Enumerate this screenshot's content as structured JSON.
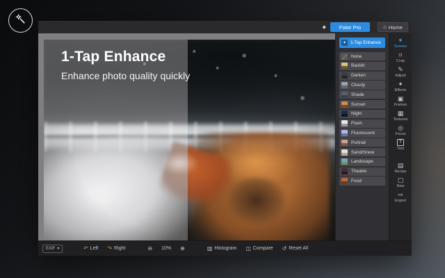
{
  "hero": {
    "title": "1-Tap Enhance",
    "subtitle": "Enhance photo quality quickly"
  },
  "topbar": {
    "pro_label": "Fotor Pro",
    "home_label": "Home",
    "gem_icon": "◆",
    "home_icon": "⌂"
  },
  "scenes_panel": {
    "active_item": "1-Tap Enhance",
    "active_icon": "✦",
    "items": [
      "None",
      "Backlit",
      "Darken",
      "Cloudy",
      "Shade",
      "Sunset",
      "Night",
      "Flash",
      "Fluorescent",
      "Portrait",
      "Sand/Snow",
      "Landscape",
      "Theatre",
      "Food"
    ]
  },
  "tools_sidebar": {
    "items": [
      {
        "label": "Scenes",
        "glyph": "✴"
      },
      {
        "label": "Crop",
        "glyph": "⌗"
      },
      {
        "label": "Adjust",
        "glyph": "✎"
      },
      {
        "label": "Effects",
        "glyph": "✦"
      },
      {
        "label": "Frames",
        "glyph": "▣"
      },
      {
        "label": "Textures",
        "glyph": "▦"
      },
      {
        "label": "Focus",
        "glyph": "◎"
      },
      {
        "label": "Text",
        "glyph": "T"
      }
    ],
    "actions": [
      {
        "label": "Recipe",
        "glyph": "▤"
      },
      {
        "label": "New",
        "glyph": "▢"
      },
      {
        "label": "Export",
        "glyph": "⇨"
      }
    ]
  },
  "statusbar": {
    "exif_label": "EXIF",
    "exif_caret": "▾",
    "rotate_left_label": "Left",
    "rotate_left_icon": "↶",
    "rotate_right_label": "Right",
    "rotate_right_icon": "↷",
    "zoom_out_icon": "⊖",
    "zoom_level": "10%",
    "zoom_in_icon": "⊕",
    "histogram_label": "Histogram",
    "histogram_icon": "▥",
    "compare_label": "Compare",
    "compare_icon": "◫",
    "reset_label": "Reset All",
    "reset_icon": "↺"
  },
  "decor": {
    "seed_glyph": "✻",
    "accent_color": "#2d8ce0",
    "active_tool_color": "#3fa2f5"
  }
}
